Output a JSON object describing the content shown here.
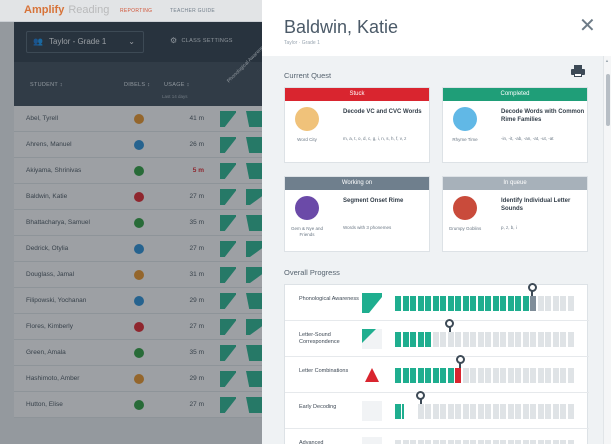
{
  "app": {
    "brand": "Amplify",
    "product": "Reading",
    "nav": [
      "REPORTING",
      "TEACHER GUIDE"
    ],
    "class_select": "Taylor - Grade 1",
    "class_settings": "CLASS SETTINGS"
  },
  "table": {
    "headers": {
      "student": "STUDENT ↕",
      "dibels": "DIBELS ↕",
      "usage": "USAGE ↕",
      "usage_sub": "Last 14 days",
      "phonological": "Phonological Awareness"
    },
    "rows": [
      {
        "name": "Abel, Tyrell",
        "dibels": "#e8952c",
        "usage": "41 m",
        "low": false,
        "b": "full"
      },
      {
        "name": "Ahrens, Manuel",
        "dibels": "#2b8fd6",
        "usage": "26 m",
        "low": false,
        "b": "full"
      },
      {
        "name": "Akiyama, Shrinivas",
        "dibels": "#2f9e41",
        "usage": "5 m",
        "low": true,
        "b": "full"
      },
      {
        "name": "Baldwin, Katie",
        "dibels": "#e0262f",
        "usage": "27 m",
        "low": false,
        "b": "half"
      },
      {
        "name": "Bhattacharya, Samuel",
        "dibels": "#2f9e41",
        "usage": "35 m",
        "low": false,
        "b": "full"
      },
      {
        "name": "Dedrick, Otylia",
        "dibels": "#2b8fd6",
        "usage": "27 m",
        "low": false,
        "b": "half"
      },
      {
        "name": "Douglass, Jamal",
        "dibels": "#e8952c",
        "usage": "31 m",
        "low": false,
        "b": "half"
      },
      {
        "name": "Filipowski, Yochanan",
        "dibels": "#2b8fd6",
        "usage": "29 m",
        "low": false,
        "b": "full"
      },
      {
        "name": "Flores, Kimberly",
        "dibels": "#e0262f",
        "usage": "27 m",
        "low": false,
        "b": "half"
      },
      {
        "name": "Green, Amala",
        "dibels": "#2f9e41",
        "usage": "35 m",
        "low": false,
        "b": "full"
      },
      {
        "name": "Hashimoto, Amber",
        "dibels": "#e8952c",
        "usage": "29 m",
        "low": false,
        "b": "full"
      },
      {
        "name": "Hutton, Elise",
        "dibels": "#2f9e41",
        "usage": "27 m",
        "low": false,
        "b": "full"
      }
    ]
  },
  "drawer": {
    "student_name": "Baldwin, Katie",
    "student_class": "Taylor · Grade 1",
    "current_quest_title": "Current Quest",
    "overall_progress_title": "Overall Progress",
    "quests": [
      {
        "status": "Stuck",
        "color": "#d9252f",
        "game": "Word City",
        "title": "Decode VC and CVC Words",
        "detail": "m, a, t, o, d, c, g, i, n, s, h, f, v, z",
        "icon_color": "#f0c27a"
      },
      {
        "status": "Completed",
        "color": "#1f9e78",
        "game": "Rhyme Time",
        "title": "Decode Words with Common Rime Families",
        "detail": "-in, -it, -ab, -an, -at, -ut, -at",
        "icon_color": "#61b8e6"
      },
      {
        "status": "Working on",
        "color": "#6f7f8d",
        "game": "Gem & Nye and Friends",
        "title": "Segment Onset Rime",
        "detail": "Words with 3 phonemes",
        "icon_color": "#6b4aa8"
      },
      {
        "status": "In queue",
        "color": "#a7b1ba",
        "game": "Grumpy Goblins",
        "title": "Identify Individual Letter Sounds",
        "detail": "p, z, b, i",
        "icon_color": "#c94b3b"
      }
    ],
    "progress": [
      {
        "label": "Phonological Awareness",
        "badge": "full",
        "filled": 0.76,
        "pin": 0.76,
        "current_color": "#1fae8f"
      },
      {
        "label": "Letter-Sound Correspondence",
        "badge": "partial",
        "filled": 0.22,
        "pin": 0.3,
        "current_color": "#1fae8f"
      },
      {
        "label": "Letter Combinations",
        "badge": "stuck",
        "filled": 0.36,
        "pin": 0.36,
        "current_color": "#d9252f"
      },
      {
        "label": "Early Decoding",
        "badge": "empty",
        "filled": 0.14,
        "pin": 0.14,
        "current_color": "#1fae8f"
      },
      {
        "label": "Advanced",
        "badge": "empty",
        "filled": 0,
        "pin": null,
        "current_color": "#1fae8f"
      }
    ]
  }
}
